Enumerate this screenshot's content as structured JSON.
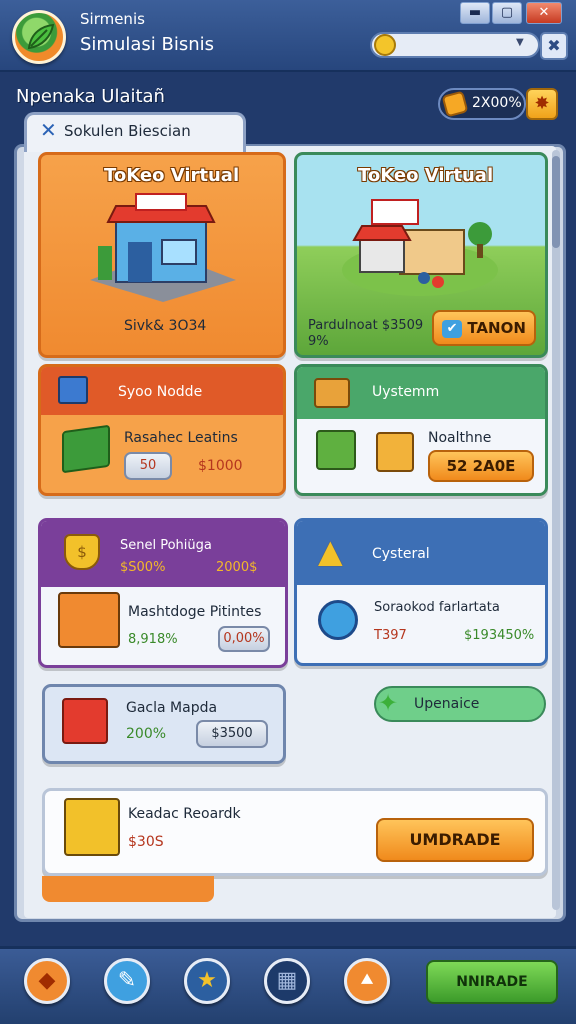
{
  "app": {
    "name": "Sirmenis",
    "subtitle": "Simulasi Bisnis"
  },
  "window": {
    "min": "▬",
    "max": "▢",
    "close": "✕"
  },
  "header": {
    "heading": "Npenaka Ulaitañ",
    "coins": "2X00%",
    "bonus_icon": "star-burst-icon"
  },
  "tab": {
    "label": "Sokulen Biescian"
  },
  "cards": {
    "store1": {
      "title": "ToKeo Virtual",
      "stat": "Sivk& 3O34"
    },
    "store2": {
      "title": "ToKeo Virtual",
      "stat": "Pardulnoat $3509",
      "stat2": "9%",
      "button": "TANON"
    },
    "mode": {
      "header": "Syoo Nodde",
      "label": "Rasahec Leatins",
      "chip": "50",
      "value": "$1000"
    },
    "system1": {
      "header": "Uystemm",
      "label": "Noalthne",
      "button": "52 2A0E"
    },
    "promo": {
      "header": "Senel Pohiüga",
      "v1": "$S00%",
      "v2": "2000$",
      "label": "Mashtdoge Pitintes",
      "green": "8,918%",
      "chip": "0,00%"
    },
    "system2": {
      "header": "Cysteral",
      "label": "Soraokod farlartata",
      "red": "T397",
      "green": "$193450%"
    },
    "upgrade_pill": {
      "label": "Upenaice"
    },
    "place": {
      "label": "Gacla Mapda",
      "green": "200%",
      "chip": "$3500"
    },
    "reward": {
      "label": "Keadac Reoardk",
      "value": "$30S",
      "button": "UMDRADE"
    }
  },
  "bottom_nav": {
    "upgrade": "NNIRADE"
  },
  "colors": {
    "orange": "#f6a24a",
    "green": "#4aa76a",
    "purple": "#7a3f9a",
    "blue": "#3d6fb5"
  }
}
